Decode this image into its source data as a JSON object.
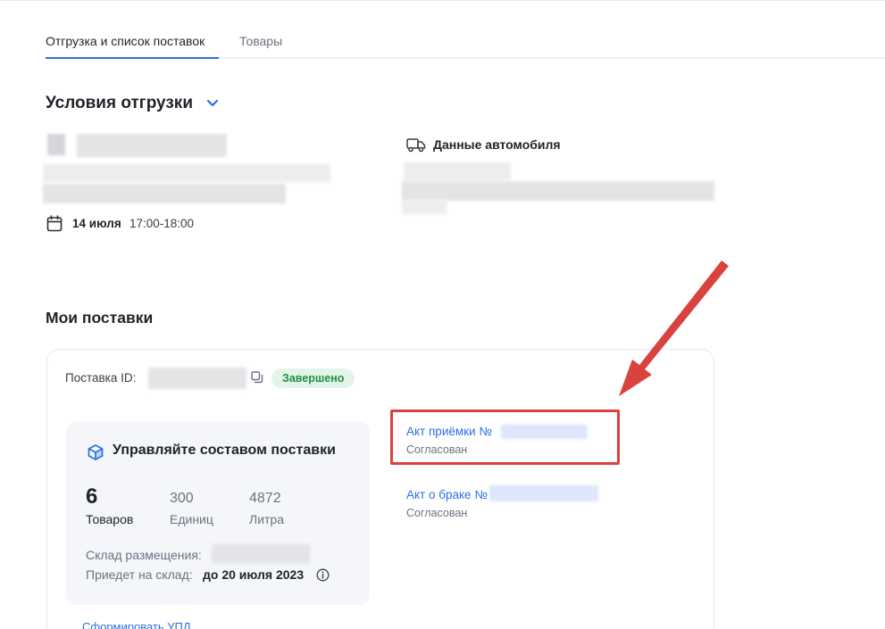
{
  "tabs": [
    {
      "label": "Отгрузка и список поставок",
      "active": true
    },
    {
      "label": "Товары",
      "active": false
    }
  ],
  "conditions": {
    "title": "Условия отгрузки",
    "date_day": "14 июля",
    "date_time": "17:00-18:00",
    "car_title": "Данные автомобиля"
  },
  "supplies": {
    "title": "Мои поставки",
    "supply_id_label": "Поставка ID:",
    "status": "Завершено",
    "manage_title": "Управляйте составом поставки",
    "stats": [
      {
        "value": "6",
        "label": "Товаров"
      },
      {
        "value": "300",
        "label": "Единиц"
      },
      {
        "value": "4872",
        "label": "Литра"
      }
    ],
    "warehouse_label": "Склад размещения:",
    "arrive_label": "Приедет на склад:",
    "arrive_value": "до 20 июля 2023",
    "udp_link": "Сформировать УПД"
  },
  "documents": [
    {
      "label": "Акт приёмки №",
      "status": "Согласован"
    },
    {
      "label": "Акт о браке №",
      "status": "Согласован"
    }
  ],
  "colors": {
    "accent": "#2d6ee8",
    "success_bg": "#e3f5e8",
    "success_text": "#1f8f3f",
    "highlight": "#d9423e"
  }
}
